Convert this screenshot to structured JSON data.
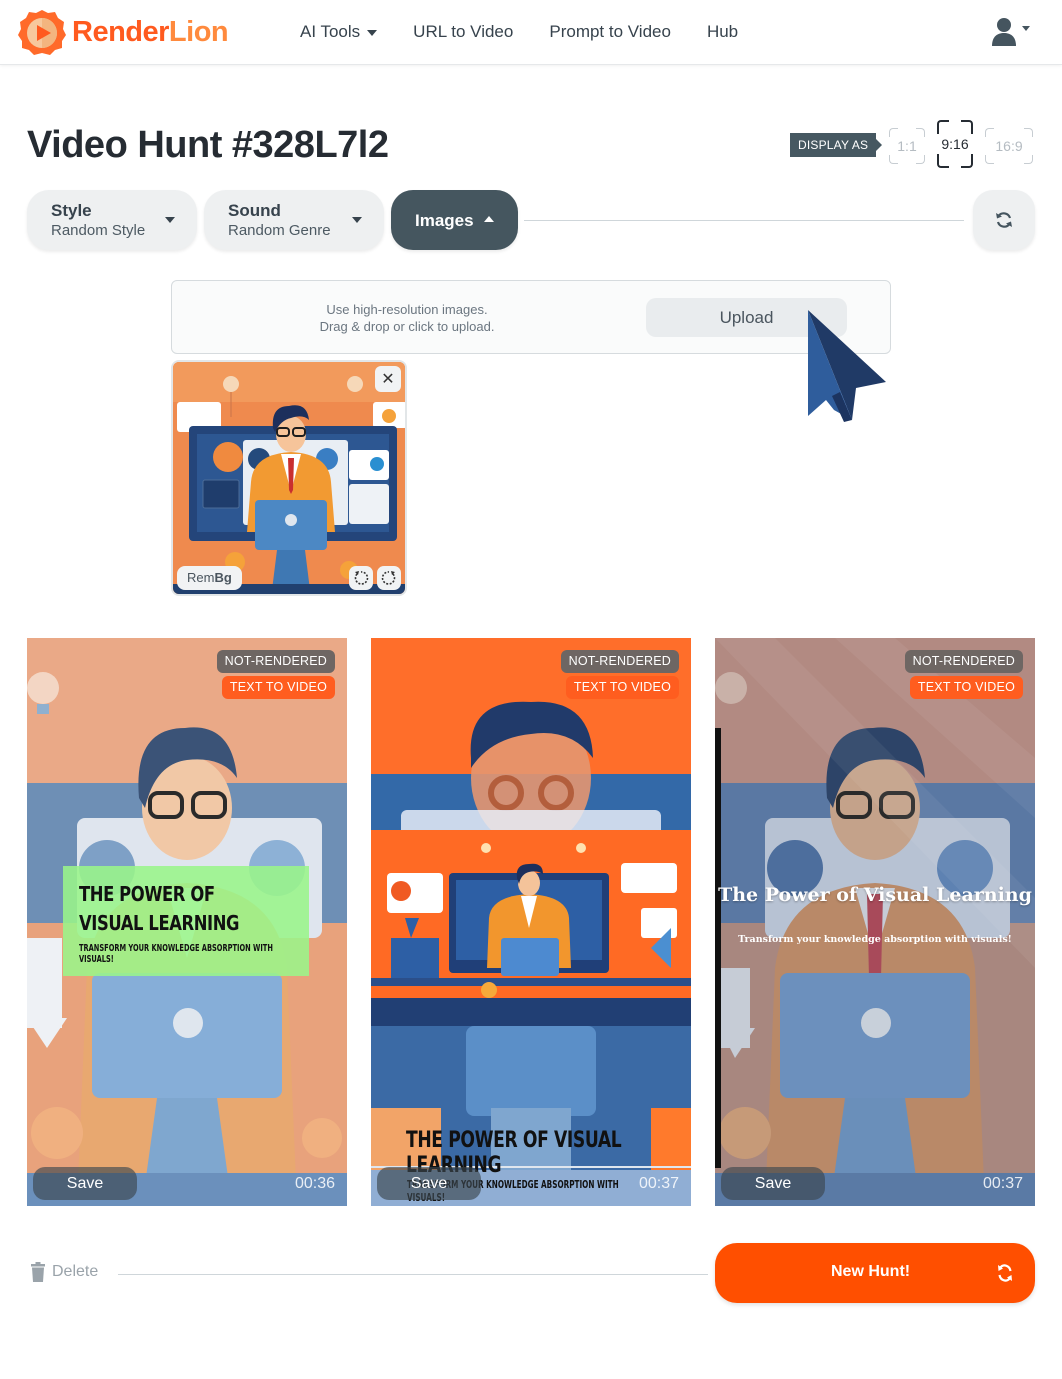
{
  "brand": {
    "name_part1": "Render",
    "name_part2": "Lion",
    "color": "#ff5a1f"
  },
  "nav": {
    "items": [
      {
        "label": "AI Tools",
        "has_dropdown": true
      },
      {
        "label": "URL to Video",
        "has_dropdown": false
      },
      {
        "label": "Prompt to Video",
        "has_dropdown": false
      },
      {
        "label": "Hub",
        "has_dropdown": false
      }
    ],
    "user_icon": "user-icon"
  },
  "page": {
    "title": "Video Hunt #328L7l2"
  },
  "display_as": {
    "label": "DISPLAY AS",
    "options": [
      {
        "label": "1:1",
        "active": false
      },
      {
        "label": "9:16",
        "active": true
      },
      {
        "label": "16:9",
        "active": false
      }
    ]
  },
  "toolbar": {
    "style": {
      "label": "Style",
      "value": "Random Style"
    },
    "sound": {
      "label": "Sound",
      "value": "Random Genre"
    },
    "images": {
      "label": "Images",
      "expanded": true
    },
    "refresh_icon": "refresh-icon"
  },
  "upload": {
    "hint_line1": "Use high-resolution images.",
    "hint_line2": "Drag & drop or click to upload.",
    "button_label": "Upload"
  },
  "uploaded_images": [
    {
      "rembg_label_regular": "Rem",
      "rembg_label_bold": "Bg",
      "close_icon": "close-icon",
      "rotate_left_icon": "rotate-left-icon",
      "rotate_right_icon": "rotate-right-icon"
    }
  ],
  "videos": [
    {
      "status_badge": "NOT-RENDERED",
      "type_badge": "TEXT TO VIDEO",
      "overlay_title": "THE POWER OF VISUAL LEARNING",
      "overlay_subtitle": "TRANSFORM YOUR KNOWLEDGE ABSORPTION WITH VISUALS!",
      "save_label": "Save",
      "duration": "00:36"
    },
    {
      "status_badge": "NOT-RENDERED",
      "type_badge": "TEXT TO VIDEO",
      "overlay_title": "THE POWER OF VISUAL LEARNING",
      "overlay_subtitle": "TRANSFORM YOUR KNOWLEDGE ABSORPTION WITH VISUALS!",
      "save_label": "Save",
      "duration": "00:37"
    },
    {
      "status_badge": "NOT-RENDERED",
      "type_badge": "TEXT TO VIDEO",
      "overlay_title": "The Power of Visual Learning",
      "overlay_subtitle": "Transform your knowledge absorption with visuals!",
      "save_label": "Save",
      "duration": "00:37"
    }
  ],
  "footer": {
    "delete_label": "Delete",
    "new_hunt_label": "New Hunt!"
  },
  "colors": {
    "accent": "#ff4f00",
    "badge_not_rendered": "#6e6663",
    "badge_text_to_video": "#ff5d1f",
    "dark_pill": "#45565f"
  }
}
